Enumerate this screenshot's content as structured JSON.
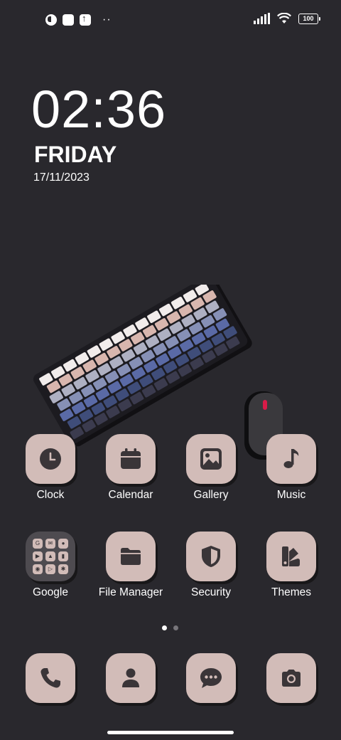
{
  "status_bar": {
    "battery": "100"
  },
  "clock": {
    "time": "02:36",
    "day": "FRIDAY",
    "date": "17/11/2023"
  },
  "apps": [
    {
      "label": "Clock",
      "icon": "clock-icon"
    },
    {
      "label": "Calendar",
      "icon": "calendar-icon"
    },
    {
      "label": "Gallery",
      "icon": "gallery-icon"
    },
    {
      "label": "Music",
      "icon": "music-note-icon"
    },
    {
      "label": "Google",
      "icon": "google-folder-icon"
    },
    {
      "label": "File Manager",
      "icon": "folder-icon"
    },
    {
      "label": "Security",
      "icon": "shield-icon"
    },
    {
      "label": "Themes",
      "icon": "themes-icon"
    }
  ],
  "dock": [
    {
      "icon": "phone-icon"
    },
    {
      "icon": "contacts-icon"
    },
    {
      "icon": "messages-icon"
    },
    {
      "icon": "camera-icon"
    }
  ],
  "pagination": {
    "pages": 2,
    "current": 1
  },
  "colors": {
    "background": "#29282d",
    "tile": "#d2bcb8",
    "tile_icon": "#3a3538"
  }
}
